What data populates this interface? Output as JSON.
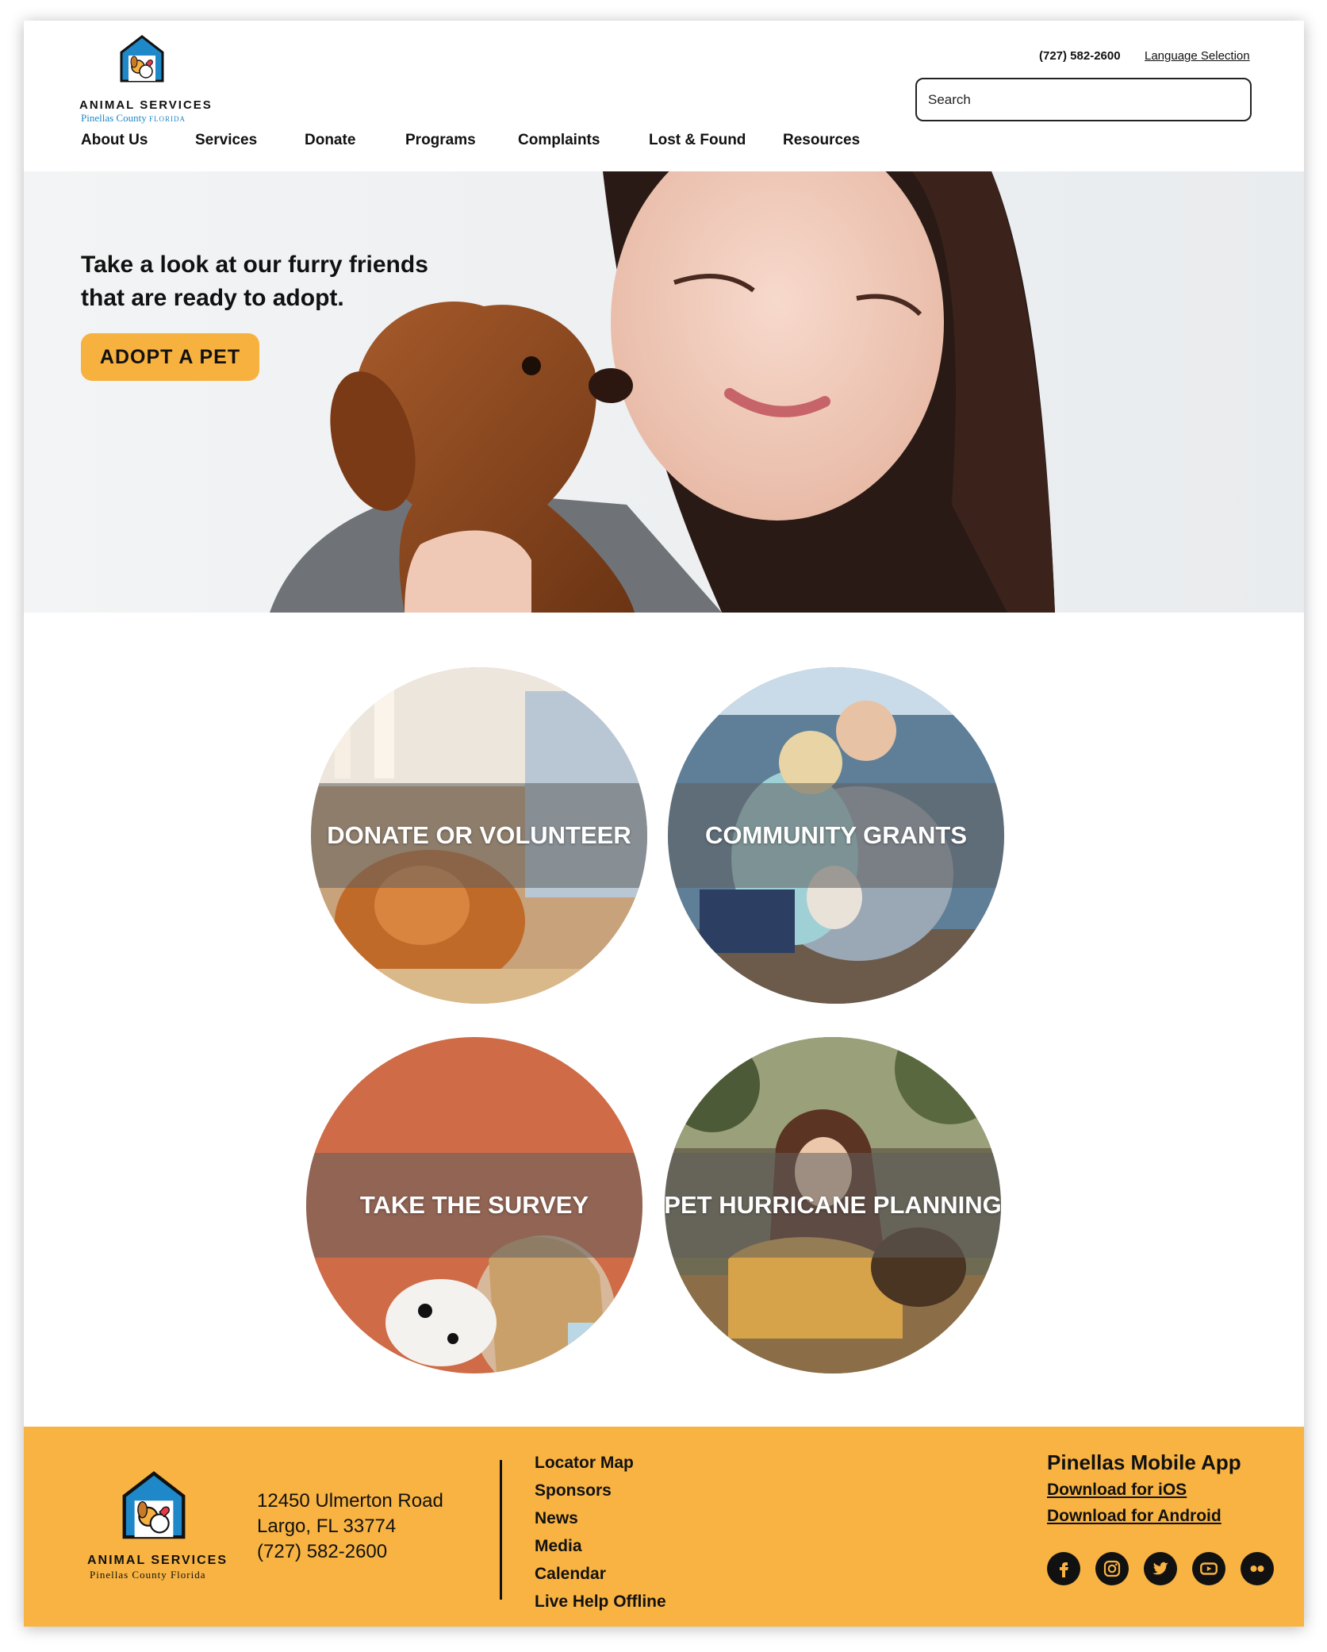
{
  "brand": {
    "name": "ANIMAL SERVICES",
    "county": "Pinellas County",
    "state": "FLORIDA",
    "footer_sub": "Pinellas County Florida",
    "colors": {
      "accent": "#f8b342",
      "logo_blue": "#1e88c8",
      "text": "#111111"
    }
  },
  "header": {
    "phone": "(727) 582-2600",
    "language": "Language Selection",
    "search_placeholder": "Search"
  },
  "nav": [
    "About Us",
    "Services",
    "Donate",
    "Programs",
    "Complaints",
    "Lost & Found",
    "Resources"
  ],
  "hero": {
    "headline_line1": "Take a look at our furry friends",
    "headline_line2": "that are ready to adopt.",
    "cta": "ADOPT A PET"
  },
  "tiles": [
    {
      "label": "DONATE OR VOLUNTEER"
    },
    {
      "label": "COMMUNITY GRANTS"
    },
    {
      "label": "TAKE THE SURVEY"
    },
    {
      "label": "PET HURRICANE PLANNING"
    }
  ],
  "footer": {
    "address_line1": "12450 Ulmerton Road",
    "address_line2": "Largo, FL 33774",
    "phone": "(727) 582-2600",
    "links": [
      "Locator Map",
      "Sponsors",
      "News",
      "Media",
      "Calendar",
      "Live Help Offline"
    ],
    "app_title": "Pinellas Mobile App",
    "ios": "Download for iOS",
    "android": "Download for Android",
    "social_icons": [
      "facebook-icon",
      "instagram-icon",
      "twitter-icon",
      "youtube-icon",
      "flickr-icon"
    ]
  }
}
